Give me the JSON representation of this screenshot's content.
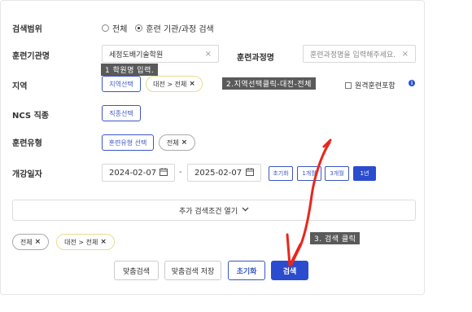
{
  "search_scope": {
    "label": "검색범위",
    "options": [
      {
        "label": "전체",
        "checked": false
      },
      {
        "label": "훈련 기관/과정 검색",
        "checked": true
      }
    ]
  },
  "institution": {
    "label": "훈련기관명",
    "value": "세정도배기술학원",
    "clear": "×"
  },
  "course_name": {
    "label": "훈련과정명",
    "placeholder": "훈련과정명을 입력해주세요.",
    "clear": "×"
  },
  "region": {
    "label": "지역",
    "select_button": "지역선택",
    "chip": "대전 > 전체",
    "remote_label": "원격훈련포함",
    "info": "i"
  },
  "ncs": {
    "label": "NCS 직종",
    "select_button": "직종선택"
  },
  "training_type": {
    "label": "훈련유형",
    "select_button": "훈련유형 선택",
    "chip": "전체"
  },
  "start_date": {
    "label": "개강일자",
    "from": "2024-02-07",
    "separator": "-",
    "to": "2025-02-07",
    "periods": [
      {
        "label": "초기화",
        "active": false
      },
      {
        "label": "1개월",
        "active": false
      },
      {
        "label": "3개월",
        "active": false
      },
      {
        "label": "1년",
        "active": true
      }
    ]
  },
  "more_conditions": {
    "label": "추가 검색조건 열기",
    "icon": "chevron-down-icon"
  },
  "selected_chips": [
    "전체",
    "대전 > 전체"
  ],
  "chip_remove": "×",
  "footer": {
    "custom_search": "맞춤검색",
    "save_custom": "맞춤검색 저장",
    "reset": "초기화",
    "search": "검색"
  },
  "annotations": {
    "step1": "1 학원명 입력.",
    "step2": "2.지역선택클릭-대전-전체",
    "step3": "3. 검색 클릭"
  },
  "colors": {
    "accent": "#2b4ccf",
    "annotation_bg": "#5a5a5a",
    "arrow": "#e8261c",
    "chip_yellow_border": "#e8dd8c"
  }
}
